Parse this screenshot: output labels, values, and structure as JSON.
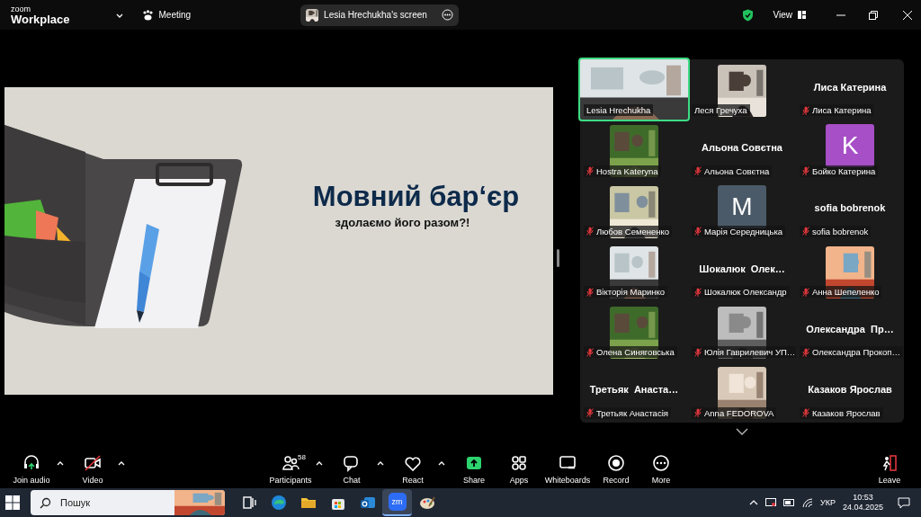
{
  "top_bar": {
    "logo_small": "zoom",
    "logo_large": "Workplace",
    "meeting_label": "Meeting",
    "share_pill": {
      "label": "Lesia Hrechukha's screen"
    },
    "view_label": "View"
  },
  "slide": {
    "title": "Мовний бар‘єр",
    "subtitle": "здолаємо його разом?!"
  },
  "gallery": [
    {
      "kind": "video",
      "label": "Lesia Hrechukha",
      "active": true,
      "muted": false
    },
    {
      "kind": "video",
      "label": "Леся Гречуха",
      "active": false,
      "muted": false
    },
    {
      "kind": "name",
      "name": "Лиса Катерина",
      "label": "Лиса Катерина",
      "active": false,
      "muted": true
    },
    {
      "kind": "video",
      "label": "Hostra Kateryna",
      "active": false,
      "muted": true
    },
    {
      "kind": "name",
      "name": "Альона Совєтна",
      "label": "Альона Совєтна",
      "active": false,
      "muted": true
    },
    {
      "kind": "avatar",
      "letter": "K",
      "color": "#a64fc6",
      "label": "Бойко Катерина",
      "active": false,
      "muted": true
    },
    {
      "kind": "video",
      "label": "Любов Семененко",
      "active": false,
      "muted": true
    },
    {
      "kind": "avatar",
      "letter": "M",
      "color": "#4b5a68",
      "label": "Марія Середницька",
      "active": false,
      "muted": true
    },
    {
      "kind": "name",
      "name": "sofia bobrenok",
      "label": "sofia bobrenok",
      "active": false,
      "muted": true
    },
    {
      "kind": "video",
      "label": "Вікторія Маринко",
      "active": false,
      "muted": true
    },
    {
      "kind": "name",
      "name": "Шокалюк  Олек…",
      "label": "Шокалюк Олександр",
      "active": false,
      "muted": true
    },
    {
      "kind": "video",
      "label": "Анна Шепеленко",
      "active": false,
      "muted": true
    },
    {
      "kind": "video",
      "label": "Олена Синяговська",
      "active": false,
      "muted": true
    },
    {
      "kind": "video",
      "label": "Юлія Гаврилевич УП…",
      "active": false,
      "muted": true
    },
    {
      "kind": "name",
      "name": "Олександра  Пр…",
      "label": "Олександра Прокоп…",
      "active": false,
      "muted": true
    },
    {
      "kind": "name",
      "name": "Третьяк  Анаста…",
      "label": "Третьяк Анастасія",
      "active": false,
      "muted": true
    },
    {
      "kind": "video",
      "label": "Anna FEDOROVA",
      "active": false,
      "muted": true
    },
    {
      "kind": "name",
      "name": "Казаков Ярослав",
      "label": "Казаков Ярослав",
      "active": false,
      "muted": true
    }
  ],
  "toolbar": [
    {
      "label": "Join audio",
      "menu": true
    },
    {
      "label": "Video",
      "menu": true,
      "off": true
    },
    {
      "label": "Participants",
      "count": "58",
      "menu": true
    },
    {
      "label": "Chat",
      "menu": true
    },
    {
      "label": "React",
      "menu": true
    },
    {
      "label": "Share",
      "menu": false
    },
    {
      "label": "Apps",
      "menu": false
    },
    {
      "label": "Whiteboards",
      "menu": false
    },
    {
      "label": "Record",
      "menu": false
    },
    {
      "label": "More",
      "menu": false
    },
    {
      "label": "Leave",
      "menu": false
    }
  ],
  "taskbar": {
    "search": {
      "placeholder": "Пошук"
    },
    "apps": [
      {
        "selected": false
      },
      {
        "selected": false
      },
      {
        "selected": false
      },
      {
        "selected": false
      },
      {
        "selected": false
      },
      {
        "selected": true,
        "label": "zm"
      },
      {
        "selected": false
      }
    ],
    "language": "УКР",
    "time": "10:53",
    "date": "24.04.2025"
  }
}
